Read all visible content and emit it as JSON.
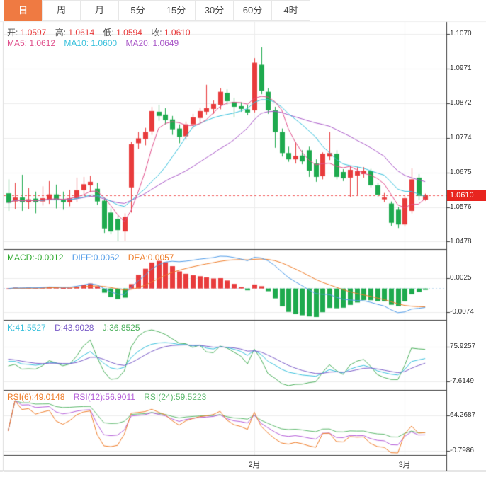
{
  "toolbar": {
    "active_index": 0,
    "tabs": [
      "日",
      "周",
      "月",
      "5分",
      "15分",
      "30分",
      "60分",
      "4时"
    ]
  },
  "main": {
    "ohlc": {
      "open_label": "开:",
      "open": "1.0597",
      "high_label": "高:",
      "high": "1.0614",
      "low_label": "低:",
      "low": "1.0594",
      "close_label": "收:",
      "close": "1.0610"
    },
    "ma": {
      "ma5": "MA5: 1.0612",
      "ma10": "MA10: 1.0600",
      "ma20": "MA20: 1.0649"
    },
    "axis_labels": [
      "1.1070",
      "1.0971",
      "1.0872",
      "1.0774",
      "1.0675",
      "1.0576",
      "1.0478"
    ],
    "current_price_label": "1.0610"
  },
  "macd": {
    "header": {
      "macd": "MACD:-0.0012",
      "diff": "DIFF:0.0052",
      "dea": "DEA:0.0057"
    },
    "axis_labels": [
      "0.0025",
      "-0.0074"
    ]
  },
  "kdj": {
    "header": {
      "k": "K:41.5527",
      "d": "D:43.9028",
      "j": "J:36.8525"
    },
    "axis_labels": [
      "75.9257",
      "-7.6149"
    ]
  },
  "rsi": {
    "header": {
      "r6": "RSI(6):49.0148",
      "r12": "RSI(12):56.9011",
      "r24": "RSI(24):59.5223"
    },
    "axis_labels": [
      "64.2687",
      "-0.7986"
    ]
  },
  "x_axis": {
    "labels": [
      {
        "text": "2月"
      },
      {
        "text": "3月"
      }
    ]
  },
  "colors": {
    "up": "#e83b3c",
    "down": "#1eaa4e",
    "ma5": "#e0508c",
    "ma10": "#38c0dc",
    "ma20": "#a958c8",
    "macd_text": "#2faa2f",
    "diff": "#4f9be8",
    "dea": "#ef7c28",
    "k": "#38c0dc",
    "d": "#7a5cc8",
    "j": "#4cb05c",
    "rsi6": "#ef7c28",
    "rsi12": "#b45cd8",
    "rsi24": "#5cb86c",
    "accent": "#ef7a42",
    "price_badge_bg": "#e8251f",
    "grid": "#ececec",
    "axis_line": "#3a3a3a",
    "price_line": "#f05a5a",
    "macd_zero_line": "#bcd8ee",
    "value_red": "#e83b3c"
  },
  "chart_data": {
    "type": "candlestick",
    "note_convention": "red = up, green = down",
    "price_axis_ticks": [
      1.107,
      1.0971,
      1.0872,
      1.0774,
      1.0675,
      1.0576,
      1.0478
    ],
    "current_price": 1.061,
    "macd_axis_ticks": [
      0.0025,
      -0.0074
    ],
    "kdj_axis_ticks": [
      75.9257,
      -7.6149
    ],
    "rsi_axis_ticks": [
      64.2687,
      -0.7986
    ],
    "x_tick_indices": [
      36,
      58
    ],
    "x_tick_labels": [
      "2月",
      "3月"
    ],
    "ma_periods": [
      5,
      10,
      20
    ],
    "macd_params": [
      12,
      26,
      9
    ],
    "kdj_params": [
      9,
      3,
      3
    ],
    "rsi_periods": [
      6,
      12,
      24
    ],
    "candles": [
      [
        1.0615,
        1.0655,
        1.0565,
        1.0588
      ],
      [
        1.0592,
        1.0645,
        1.057,
        1.0603
      ],
      [
        1.0603,
        1.0668,
        1.0565,
        1.059
      ],
      [
        1.059,
        1.063,
        1.057,
        1.0598
      ],
      [
        1.06,
        1.062,
        1.0558,
        1.059
      ],
      [
        1.0592,
        1.0635,
        1.058,
        1.0601
      ],
      [
        1.0596,
        1.065,
        1.0585,
        1.0612
      ],
      [
        1.0612,
        1.064,
        1.0572,
        1.0596
      ],
      [
        1.0598,
        1.062,
        1.0568,
        1.059
      ],
      [
        1.059,
        1.0625,
        1.0578,
        1.0601
      ],
      [
        1.0601,
        1.066,
        1.059,
        1.0624
      ],
      [
        1.0624,
        1.0662,
        1.0608,
        1.0641
      ],
      [
        1.0638,
        1.0665,
        1.0618,
        1.0648
      ],
      [
        1.0628,
        1.0645,
        1.0582,
        1.0592
      ],
      [
        1.0594,
        1.06,
        1.0502,
        1.0515
      ],
      [
        1.056,
        1.0572,
        1.0498,
        1.0506
      ],
      [
        1.0542,
        1.0552,
        1.0478,
        1.051
      ],
      [
        1.0506,
        1.0558,
        1.048,
        1.0548
      ],
      [
        1.0632,
        1.0762,
        1.056,
        1.0755
      ],
      [
        1.0758,
        1.079,
        1.0742,
        1.0772
      ],
      [
        1.077,
        1.0802,
        1.0752,
        1.079
      ],
      [
        1.0792,
        1.0862,
        1.0782,
        1.085
      ],
      [
        1.0848,
        1.0868,
        1.0822,
        1.0836
      ],
      [
        1.084,
        1.0858,
        1.0812,
        1.0824
      ],
      [
        1.0826,
        1.0836,
        1.0782,
        1.0798
      ],
      [
        1.08,
        1.0812,
        1.0758,
        1.0776
      ],
      [
        1.0778,
        1.082,
        1.0768,
        1.0812
      ],
      [
        1.0812,
        1.0842,
        1.08,
        1.0832
      ],
      [
        1.083,
        1.086,
        1.0815,
        1.085
      ],
      [
        1.0848,
        1.0925,
        1.084,
        1.0858
      ],
      [
        1.0856,
        1.088,
        1.0842,
        1.087
      ],
      [
        1.0868,
        1.0915,
        1.0855,
        1.0905
      ],
      [
        1.0902,
        1.0912,
        1.0868,
        1.0878
      ],
      [
        1.0876,
        1.0888,
        1.0832,
        1.0862
      ],
      [
        1.0864,
        1.0875,
        1.0848,
        1.0856
      ],
      [
        1.0855,
        1.0868,
        1.0838,
        1.0846
      ],
      [
        1.0852,
        1.1001,
        1.0846,
        1.0988
      ],
      [
        1.0982,
        1.1032,
        1.0898,
        1.0908
      ],
      [
        1.0905,
        1.0915,
        1.0842,
        1.0852
      ],
      [
        1.0852,
        1.0862,
        1.0745,
        1.079
      ],
      [
        1.079,
        1.08,
        1.072,
        1.073
      ],
      [
        1.073,
        1.0748,
        1.0705,
        1.0712
      ],
      [
        1.0712,
        1.0762,
        1.07,
        1.0722
      ],
      [
        1.0723,
        1.0738,
        1.0698,
        1.0706
      ],
      [
        1.0738,
        1.0748,
        1.0662,
        1.068
      ],
      [
        1.07,
        1.0712,
        1.0648,
        1.0662
      ],
      [
        1.0664,
        1.0732,
        1.0655,
        1.0728
      ],
      [
        1.072,
        1.079,
        1.071,
        1.073
      ],
      [
        1.0728,
        1.0738,
        1.0655,
        1.0662
      ],
      [
        1.0676,
        1.0684,
        1.065,
        1.0658
      ],
      [
        1.066,
        1.0692,
        1.0605,
        1.0682
      ],
      [
        1.0666,
        1.069,
        1.061,
        1.0678
      ],
      [
        1.067,
        1.069,
        1.066,
        1.0679
      ],
      [
        1.0679,
        1.0685,
        1.0632,
        1.0638
      ],
      [
        1.0638,
        1.0645,
        1.0605,
        1.0611
      ],
      [
        1.0598,
        1.0616,
        1.059,
        1.0603
      ],
      [
        1.0586,
        1.0592,
        1.0522,
        1.0531
      ],
      [
        1.0568,
        1.0576,
        1.0516,
        1.0526
      ],
      [
        1.0526,
        1.0608,
        1.052,
        1.0601
      ],
      [
        1.0565,
        1.0686,
        1.0558,
        1.0655
      ],
      [
        1.066,
        1.067,
        1.0596,
        1.0608
      ],
      [
        1.0597,
        1.0614,
        1.0594,
        1.061
      ]
    ]
  }
}
